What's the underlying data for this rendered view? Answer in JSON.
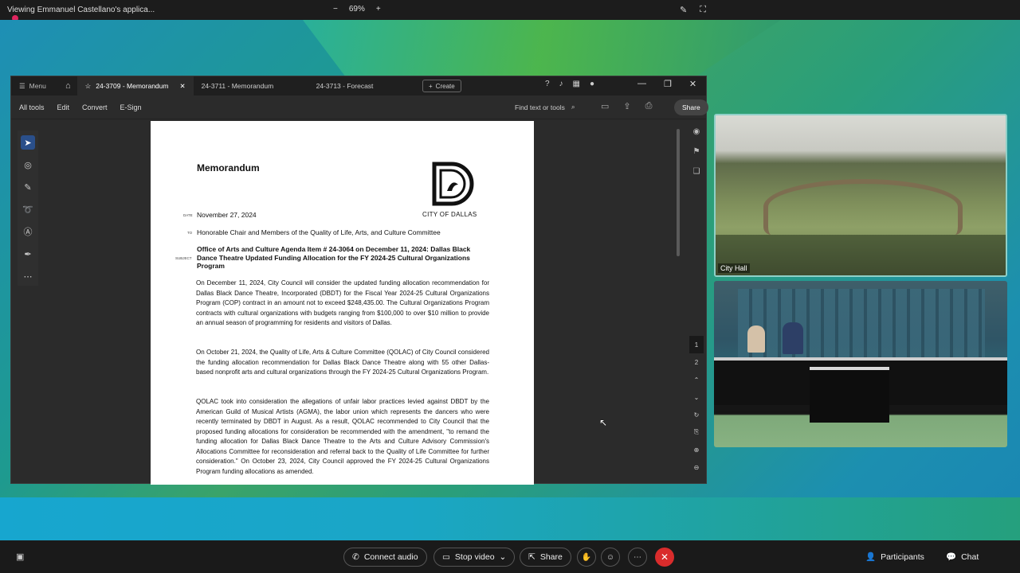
{
  "meeting": {
    "share_label": "Viewing Emmanuel Castellano's applica...",
    "zoom_minus": "−",
    "zoom_value": "69%",
    "zoom_plus": "+"
  },
  "acrobat": {
    "menu_label": "Menu",
    "tabs": [
      {
        "label": "24-3709 - Memorandum",
        "active": true
      },
      {
        "label": "24-3711 - Memorandum",
        "active": false
      },
      {
        "label": "24-3713 - Forecast",
        "active": false
      }
    ],
    "create_label": "Create",
    "toolbar": [
      "All tools",
      "Edit",
      "Convert",
      "E-Sign"
    ],
    "find_label": "Find text or tools",
    "share_label": "Share",
    "page_numbers": [
      "1",
      "2"
    ]
  },
  "document": {
    "title": "Memorandum",
    "city_name": "CITY OF DALLAS",
    "label_date": "DATE",
    "label_to": "TO",
    "label_subject": "SUBJECT",
    "date": "November 27, 2024",
    "to": "Honorable Chair and Members of the Quality of Life, Arts, and Culture Committee",
    "subject": "Office of Arts and Culture Agenda Item # 24-3064 on December 11, 2024: Dallas Black Dance Theatre Updated Funding Allocation for the FY 2024-25 Cultural Organizations Program",
    "para1": "On December 11, 2024, City Council will consider the updated funding allocation recommendation for Dallas Black Dance Theatre, Incorporated (DBDT) for the Fiscal Year 2024-25 Cultural Organizations Program (COP) contract in an amount not to exceed $248,435.00. The Cultural Organizations Program contracts with cultural organizations with budgets ranging from $100,000 to over $10 million to provide an annual season of programming for residents and visitors of Dallas.",
    "para2": "On October 21, 2024, the Quality of Life, Arts & Culture Committee (QOLAC) of City Council considered the funding allocation recommendation for Dallas Black Dance Theatre along with 55 other Dallas-based nonprofit arts and cultural organizations through the FY 2024-25 Cultural Organizations Program.",
    "para3": "QOLAC took into consideration the allegations of unfair labor practices levied against DBDT by the American Guild of Musical Artists (AGMA), the labor union which represents the dancers who were recently terminated by DBDT in August. As a result, QOLAC recommended to City Council that the proposed funding allocations for consideration be recommended with the amendment, \"to remand the funding allocation for Dallas Black Dance Theatre to the Arts and Culture Advisory Commission's Allocations Committee for reconsideration and referral back to the Quality of Life Committee for further consideration.\" On October 23, 2024, City Council approved the FY 2024-25 Cultural Organizations Program funding allocations as amended."
  },
  "video": {
    "city_hall_label": "City Hall"
  },
  "bottombar": {
    "connect_audio": "Connect audio",
    "stop_video": "Stop video",
    "share": "Share",
    "participants": "Participants",
    "chat": "Chat"
  },
  "colors": {
    "end_call": "#d92c2c",
    "active_tool": "#2a4f8a"
  }
}
